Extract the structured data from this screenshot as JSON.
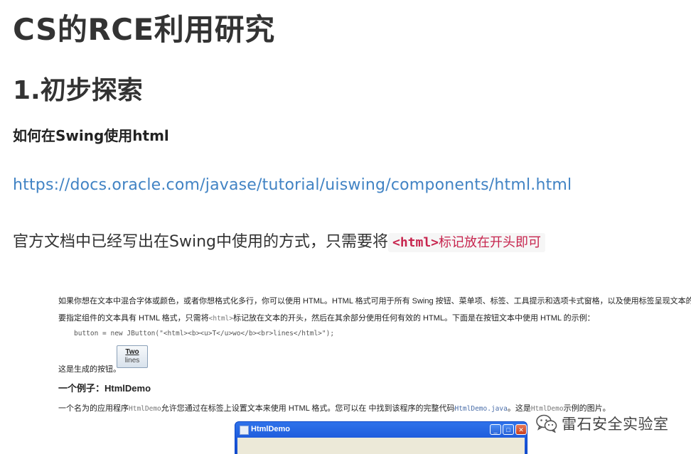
{
  "article": {
    "title": "CS的RCE利用研究",
    "section": "1.初步探索",
    "subheading": "如何在Swing使用html",
    "link": "https://docs.oracle.com/javase/tutorial/uiswing/components/html.html",
    "para_text": "官方文档中已经写出在Swing中使用的方式，只需要将",
    "para_code_tag": "<html>",
    "para_code_rest": "标记放在开头即可"
  },
  "screenshot": {
    "line1": "如果你想在文本中混合字体或颜色，或者你想格式化多行，你可以使用 HTML。HTML 格式可用于所有 Swing 按钮、菜单项、标签、工具提示和选项卡式窗格，以及使用标签呈现文本的树和表格等组件中。",
    "line2_a": "要指定组件的文本具有 HTML 格式，只需将",
    "line2_code": "<html>",
    "line2_b": "标记放在文本的开头，然后在其余部分使用任何有效的 HTML。下面是在按钮文本中使用 HTML 的示例：",
    "code": "button = new JButton(\"<html><b><u>T</u>wo</b><br>lines</html>\");",
    "result_label": "这是生成的按钮。",
    "button_line1": "Two",
    "button_line2": "lines",
    "example_title": "一个例子：HtmlDemo",
    "line3_a": "一个名为的应用程序",
    "line3_code1": "HtmlDemo",
    "line3_b": "允许您通过在标签上设置文本来使用 HTML 格式。您可以在 中找到该程序的完整代码",
    "line3_link": "HtmlDemo.java",
    "line3_c": "。这是",
    "line3_code2": "HtmlDemo",
    "line3_d": "示例的图片。",
    "window_title": "HtmlDemo"
  },
  "watermark": {
    "text": "雷石安全实验室",
    "icon": "wechat-icon"
  }
}
